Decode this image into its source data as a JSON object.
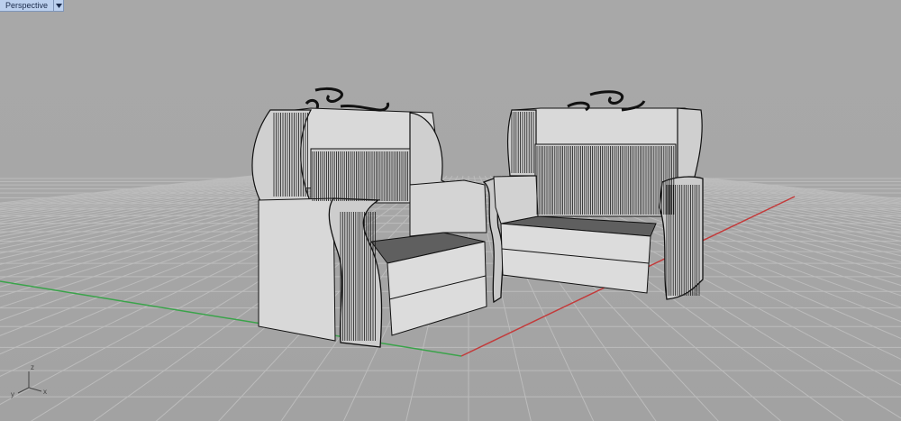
{
  "viewport": {
    "name": "Perspective",
    "menu_icon": "triangle-down-icon"
  },
  "axes": {
    "x_label": "x",
    "y_label": "y",
    "z_label": "z"
  },
  "colors": {
    "background": "#a7a7a7",
    "grid": "#bdbdbd",
    "x_axis": "#c33a3a",
    "y_axis": "#3aa34a",
    "model_fill": "#d8d8d8",
    "model_edges": "#111111",
    "tab_active": "#bcd0ee"
  }
}
